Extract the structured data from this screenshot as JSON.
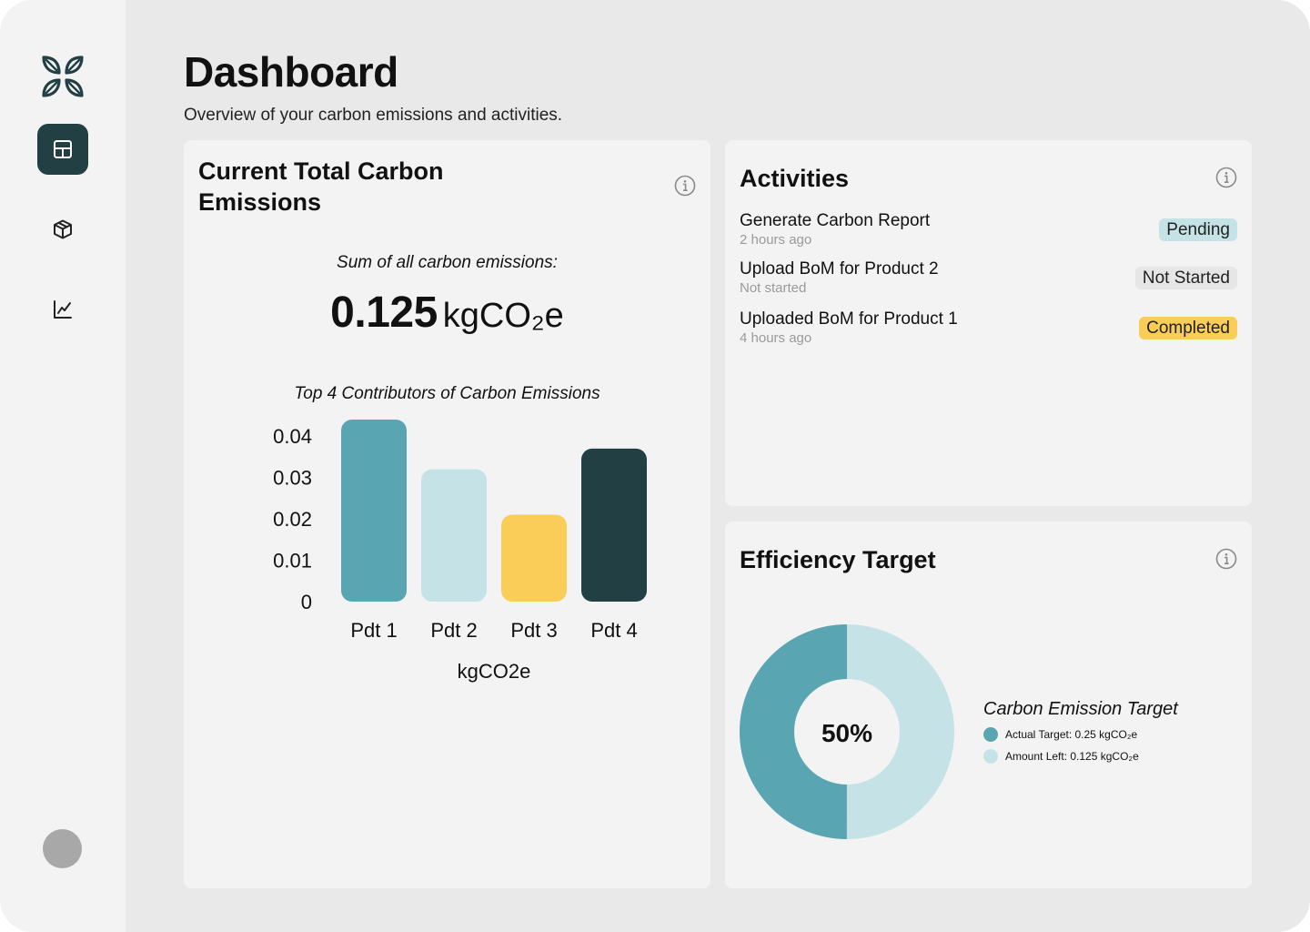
{
  "page": {
    "title": "Dashboard",
    "subtitle": "Overview of your carbon emissions and activities."
  },
  "sidebar": {
    "logo_icon": "leaf-grid-logo",
    "items": [
      {
        "icon": "layout-icon",
        "active": true
      },
      {
        "icon": "box-icon",
        "active": false
      },
      {
        "icon": "line-chart-icon",
        "active": false
      }
    ],
    "avatar": "avatar"
  },
  "carbon_card": {
    "title": "Current Total Carbon Emissions",
    "sum_label": "Sum of all carbon emissions:",
    "total_value": "0.125",
    "total_unit": "kgCO₂e",
    "chart_title": "Top 4 Contributors of Carbon Emissions"
  },
  "activities": {
    "title": "Activities",
    "items": [
      {
        "title": "Generate Carbon Report",
        "meta": "2 hours ago",
        "status": "Pending",
        "status_color": "#c5e3e6"
      },
      {
        "title": "Upload BoM for Product 2",
        "meta": "Not started",
        "status": "Not Started",
        "status_color": "#e6e6e6"
      },
      {
        "title": "Uploaded BoM for Product 1",
        "meta": "4 hours ago",
        "status": "Completed",
        "status_color": "#f9cd58"
      }
    ]
  },
  "efficiency": {
    "title": "Efficiency Target",
    "center_label": "50%",
    "progress": 0.5,
    "legend_title": "Carbon Emission Target",
    "legend": [
      {
        "label": "Actual Target: 0.25 kgCO₂e",
        "color": "#5aa5b2"
      },
      {
        "label": "Amount Left: 0.125 kgCO₂e",
        "color": "#c5e3e6"
      }
    ]
  },
  "colors": {
    "accent_dark": "#223f44",
    "teal": "#5aa5b2",
    "light_teal": "#c5e3e6",
    "yellow": "#f9cd58"
  },
  "chart_data": {
    "type": "bar",
    "title": "Top 4 Contributors of Carbon Emissions",
    "categories": [
      "Pdt 1",
      "Pdt 2",
      "Pdt 3",
      "Pdt 4"
    ],
    "values": [
      0.044,
      0.032,
      0.021,
      0.037
    ],
    "colors": [
      "#5aa5b2",
      "#c5e3e6",
      "#f9cd58",
      "#223f44"
    ],
    "yticks": [
      "0.04",
      "0.03",
      "0.02",
      "0.01",
      "0"
    ],
    "ytick_values": [
      0.04,
      0.03,
      0.02,
      0.01,
      0
    ],
    "ylim": [
      0,
      0.044
    ],
    "xlabel": "kgCO2e",
    "ylabel": "",
    "grid": false
  }
}
